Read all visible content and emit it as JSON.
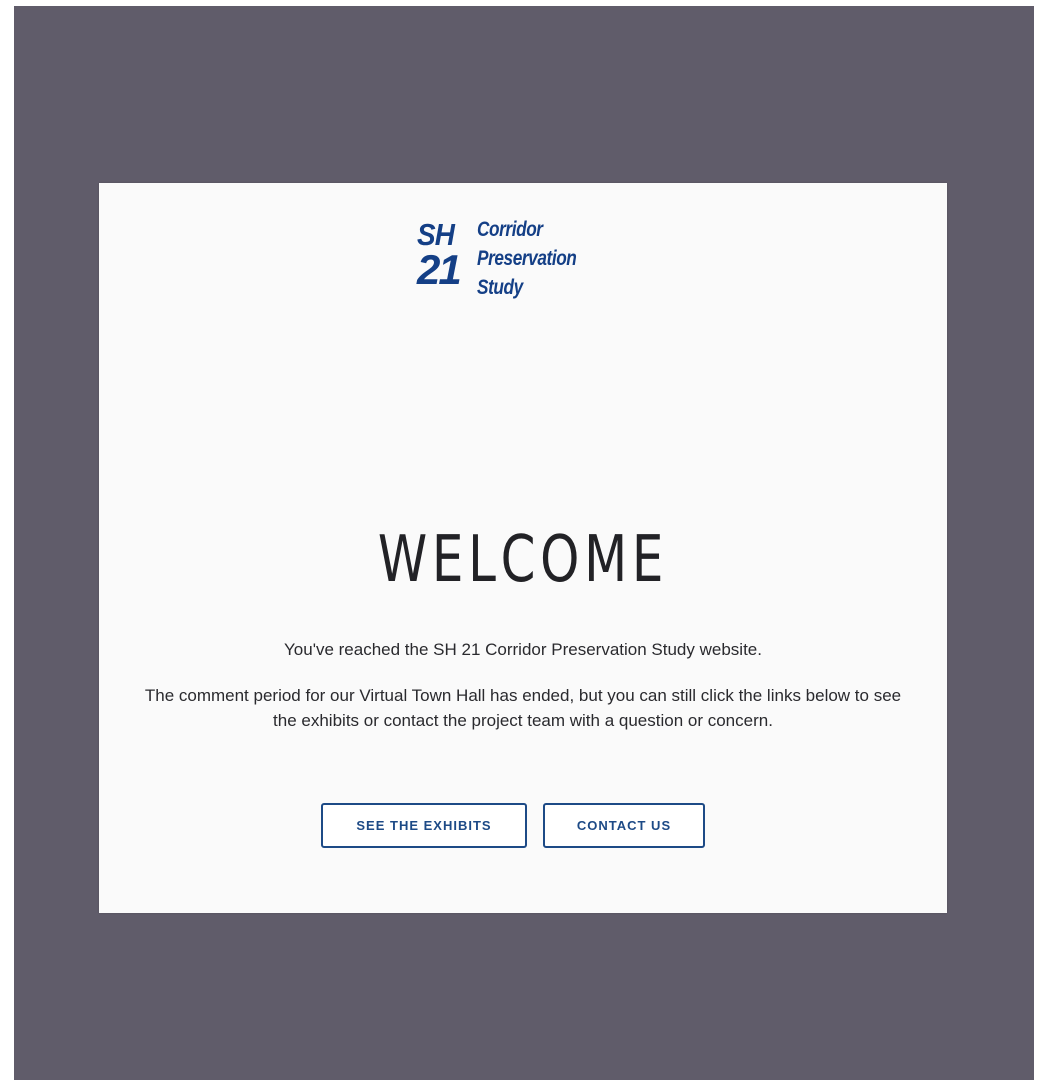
{
  "logo": {
    "sh": "SH",
    "number": "21",
    "line1": "Corridor",
    "line2": "Preservation",
    "line3": "Study"
  },
  "welcome": {
    "title": "WELCOME",
    "subtitle": "You've reached the SH 21 Corridor Preservation Study website.",
    "body": "The comment period for our Virtual Town Hall has ended, but you can still click the links below to see the exhibits or contact the project team with a question or concern."
  },
  "buttons": {
    "exhibits": "SEE THE EXHIBITS",
    "contact": "CONTACT US"
  },
  "colors": {
    "backdrop": "#605c6a",
    "brand_blue": "#143f86",
    "button_border": "#1d4a86"
  }
}
